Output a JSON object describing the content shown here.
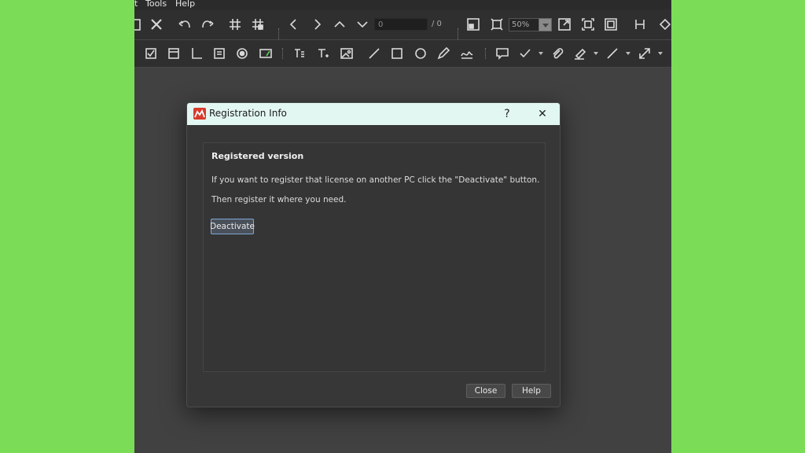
{
  "menubar": {
    "items": [
      "t",
      "Tools",
      "Help"
    ]
  },
  "toolbar": {
    "page_input_value": "0",
    "page_total": "/ 0",
    "zoom_value": "50%"
  },
  "dialog": {
    "title": "Registration Info",
    "help_glyph": "?",
    "close_glyph": "✕",
    "heading": "Registered version",
    "line1": "If you want to register that license on another PC click the \"Deactivate\" button.",
    "line2": "Then register it where you need.",
    "deactivate_label": "Deactivate",
    "close_label": "Close",
    "help_label": "Help"
  },
  "colors": {
    "background_green": "#7bdc58",
    "titlebar": "#e3f7f2",
    "logo_red": "#d93a2b",
    "accent_blue": "#7fa6d8"
  }
}
